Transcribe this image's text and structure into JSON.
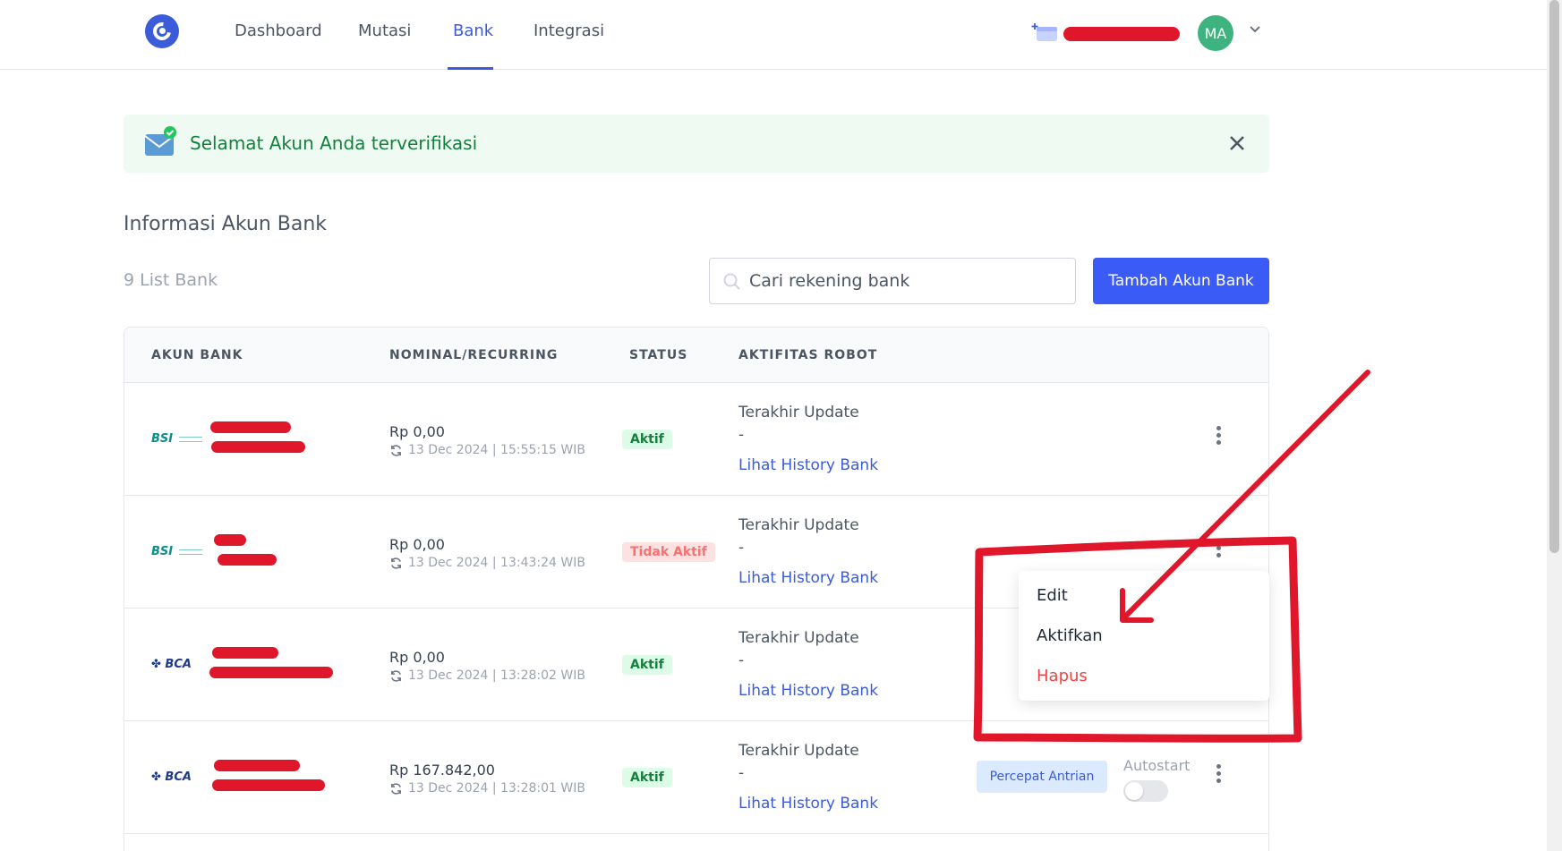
{
  "nav": {
    "items": [
      "Dashboard",
      "Mutasi",
      "Bank",
      "Integrasi"
    ],
    "active": "Bank",
    "avatar_initials": "MA"
  },
  "alert": {
    "message": "Selamat Akun Anda terverifikasi"
  },
  "section": {
    "title": "Informasi Akun Bank",
    "count_label": "9 List Bank"
  },
  "search": {
    "placeholder": "Cari rekening bank"
  },
  "add_button_label": "Tambah Akun Bank",
  "table": {
    "headers": [
      "AKUN BANK",
      "NOMINAL/RECURRING",
      "STATUS",
      "AKTIFITAS ROBOT"
    ],
    "rows": [
      {
        "bank": "BSI",
        "nominal": "Rp 0,00",
        "timestamp": "13 Dec 2024 | 15:55:15 WIB",
        "status": "Aktif",
        "update_label": "Terakhir Update",
        "update_value": "-",
        "history_link": "Lihat History Bank"
      },
      {
        "bank": "BSI",
        "nominal": "Rp 0,00",
        "timestamp": "13 Dec 2024 | 13:43:24 WIB",
        "status": "Tidak Aktif",
        "update_label": "Terakhir Update",
        "update_value": "-",
        "history_link": "Lihat History Bank"
      },
      {
        "bank": "BCA",
        "nominal": "Rp 0,00",
        "timestamp": "13 Dec 2024 | 13:28:02 WIB",
        "status": "Aktif",
        "update_label": "Terakhir Update",
        "update_value": "-",
        "history_link": "Lihat History Bank"
      },
      {
        "bank": "BCA",
        "nominal": "Rp 167.842,00",
        "timestamp": "13 Dec 2024 | 13:28:01 WIB",
        "status": "Aktif",
        "update_label": "Terakhir Update",
        "update_value": "-",
        "history_link": "Lihat History Bank",
        "queue_button": "Percepat Antrian",
        "autostart_label": "Autostart"
      }
    ]
  },
  "dropdown": {
    "items": [
      "Edit",
      "Aktifkan",
      "Hapus"
    ]
  },
  "colors": {
    "accent": "#3b5bdb",
    "annotation": "#e0162b",
    "success": "#15803d",
    "danger": "#ef4444"
  }
}
